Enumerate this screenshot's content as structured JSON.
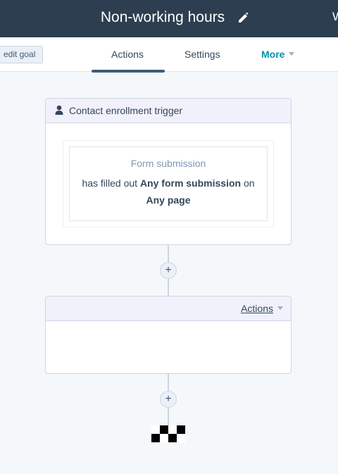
{
  "header": {
    "title": "Non-working hours",
    "cut_text": "W"
  },
  "toolbar": {
    "edit_goal_label": "edit goal"
  },
  "tabs": [
    {
      "label": "Actions",
      "active": true
    },
    {
      "label": "Settings",
      "active": false
    },
    {
      "label": "More",
      "active": false
    }
  ],
  "trigger_card": {
    "title": "Contact enrollment trigger",
    "filter_type": "Form submission",
    "filter_prefix": "has filled out",
    "filter_value": "Any form submission",
    "filter_conj": "on",
    "filter_page": "Any page"
  },
  "plus_label": "+",
  "actions_card": {
    "dropdown_label": "Actions"
  },
  "colors": {
    "topbar": "#2d3e50",
    "accent": "#0091ae",
    "card_header": "#f0f1fa",
    "border": "#cbd6e2"
  },
  "icons": [
    "pencil-icon",
    "person-icon",
    "caret-down-icon",
    "plus-icon",
    "finish-flag-icon"
  ]
}
